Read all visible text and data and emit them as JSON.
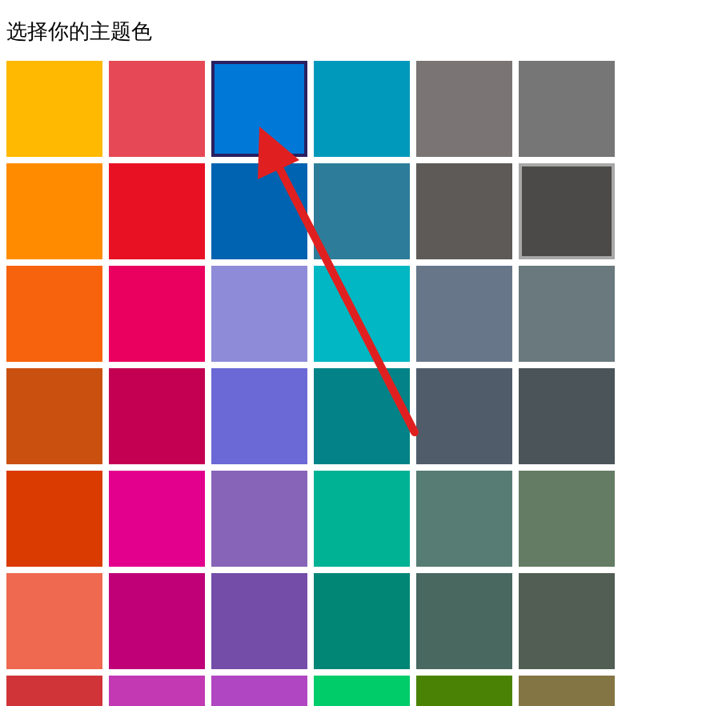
{
  "title": "选择你的主题色",
  "swatches": [
    {
      "color": "#ffb900",
      "selected": false,
      "hovered": false
    },
    {
      "color": "#e74856",
      "selected": false,
      "hovered": false
    },
    {
      "color": "#0078d7",
      "selected": true,
      "hovered": false
    },
    {
      "color": "#0099bc",
      "selected": false,
      "hovered": false
    },
    {
      "color": "#7a7574",
      "selected": false,
      "hovered": false
    },
    {
      "color": "#767676",
      "selected": false,
      "hovered": false
    },
    {
      "color": "#ff8c00",
      "selected": false,
      "hovered": false
    },
    {
      "color": "#e81123",
      "selected": false,
      "hovered": false
    },
    {
      "color": "#0063b1",
      "selected": false,
      "hovered": false
    },
    {
      "color": "#2d7d9a",
      "selected": false,
      "hovered": false
    },
    {
      "color": "#5d5a58",
      "selected": false,
      "hovered": false
    },
    {
      "color": "#4c4a48",
      "selected": false,
      "hovered": true
    },
    {
      "color": "#f7630c",
      "selected": false,
      "hovered": false
    },
    {
      "color": "#ea005e",
      "selected": false,
      "hovered": false
    },
    {
      "color": "#8e8cd8",
      "selected": false,
      "hovered": false
    },
    {
      "color": "#00b7c3",
      "selected": false,
      "hovered": false
    },
    {
      "color": "#68768a",
      "selected": false,
      "hovered": false
    },
    {
      "color": "#69797e",
      "selected": false,
      "hovered": false
    },
    {
      "color": "#ca5010",
      "selected": false,
      "hovered": false
    },
    {
      "color": "#c30052",
      "selected": false,
      "hovered": false
    },
    {
      "color": "#6b69d6",
      "selected": false,
      "hovered": false
    },
    {
      "color": "#038387",
      "selected": false,
      "hovered": false
    },
    {
      "color": "#515c6b",
      "selected": false,
      "hovered": false
    },
    {
      "color": "#4a5459",
      "selected": false,
      "hovered": false
    },
    {
      "color": "#da3b01",
      "selected": false,
      "hovered": false
    },
    {
      "color": "#e3008c",
      "selected": false,
      "hovered": false
    },
    {
      "color": "#8764b8",
      "selected": false,
      "hovered": false
    },
    {
      "color": "#00b294",
      "selected": false,
      "hovered": false
    },
    {
      "color": "#567c73",
      "selected": false,
      "hovered": false
    },
    {
      "color": "#647c64",
      "selected": false,
      "hovered": false
    },
    {
      "color": "#ef6950",
      "selected": false,
      "hovered": false
    },
    {
      "color": "#bf0077",
      "selected": false,
      "hovered": false
    },
    {
      "color": "#744da9",
      "selected": false,
      "hovered": false
    },
    {
      "color": "#018574",
      "selected": false,
      "hovered": false
    },
    {
      "color": "#486860",
      "selected": false,
      "hovered": false
    },
    {
      "color": "#525e54",
      "selected": false,
      "hovered": false
    },
    {
      "color": "#d13438",
      "selected": false,
      "hovered": false
    },
    {
      "color": "#c239b3",
      "selected": false,
      "hovered": false
    },
    {
      "color": "#b146c2",
      "selected": false,
      "hovered": false
    },
    {
      "color": "#00cc6a",
      "selected": false,
      "hovered": false
    },
    {
      "color": "#498205",
      "selected": false,
      "hovered": false
    },
    {
      "color": "#847545",
      "selected": false,
      "hovered": false
    }
  ]
}
